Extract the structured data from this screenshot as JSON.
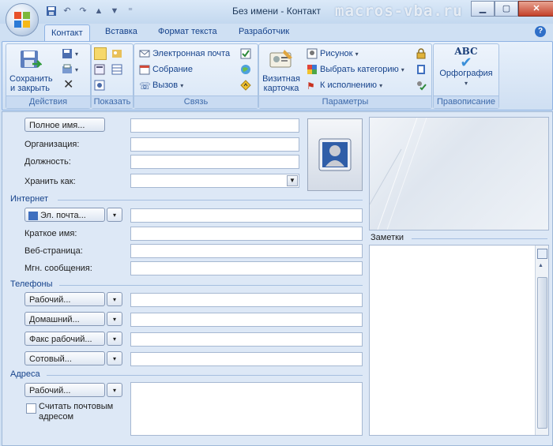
{
  "window": {
    "title": "Без имени - Контакт",
    "watermark": "macros-vba.ru"
  },
  "tabs": [
    {
      "label": "Контакт",
      "active": true
    },
    {
      "label": "Вставка"
    },
    {
      "label": "Формат текста"
    },
    {
      "label": "Разработчик"
    }
  ],
  "ribbon": {
    "groups": {
      "actions": "Действия",
      "show": "Показать",
      "communicate": "Связь",
      "options": "Параметры",
      "proofing": "Правописание"
    },
    "save_close": [
      "Сохранить",
      "и закрыть"
    ],
    "email": "Электронная почта",
    "meeting": "Собрание",
    "call": "Вызов",
    "business_card": [
      "Визитная",
      "карточка"
    ],
    "picture": "Рисунок",
    "categorize": "Выбрать категорию",
    "follow_up": "К исполнению",
    "spelling": "Орфография",
    "spelling_icon_text": "ABC"
  },
  "form": {
    "full_name_btn": "Полное имя...",
    "company_label": "Организация:",
    "job_title_label": "Должность:",
    "file_as_label": "Хранить как:",
    "internet_section": "Интернет",
    "email_btn": "Эл. почта...",
    "display_name_label": "Краткое имя:",
    "web_page_label": "Веб-страница:",
    "im_label": "Мгн. сообщения:",
    "phones_section": "Телефоны",
    "phone_work_btn": "Рабочий...",
    "phone_home_btn": "Домашний...",
    "phone_fax_btn": "Факс рабочий...",
    "phone_mobile_btn": "Сотовый...",
    "addresses_section": "Адреса",
    "address_work_btn": "Рабочий...",
    "mailing_checkbox": [
      "Считать почтовым",
      "адресом"
    ],
    "notes_label": "Заметки"
  }
}
